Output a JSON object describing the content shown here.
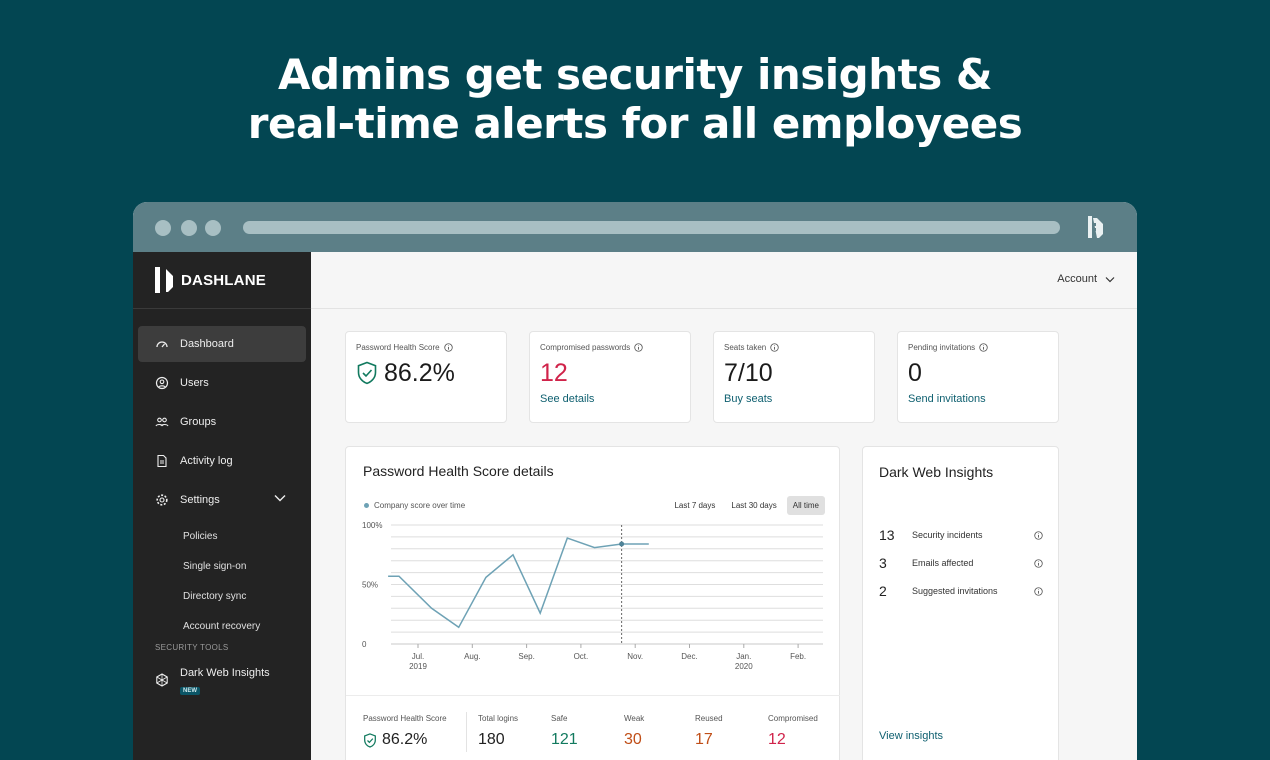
{
  "hero": {
    "line1": "Admins get security insights &",
    "line2": "real-time alerts for all employees"
  },
  "colors": {
    "background": "#034652",
    "sidebar": "#232323",
    "accent": "#0f6070",
    "red": "#d0234a",
    "green": "#127a5f",
    "orange": "#c04e17",
    "chart_line": "#6ea2b5"
  },
  "sidebar": {
    "brand": "DASHLANE",
    "items": [
      {
        "label": "Dashboard",
        "icon": "gauge-icon",
        "active": true
      },
      {
        "label": "Users",
        "icon": "user-circle-icon"
      },
      {
        "label": "Groups",
        "icon": "group-icon"
      },
      {
        "label": "Activity log",
        "icon": "document-icon"
      },
      {
        "label": "Settings",
        "icon": "gear-icon"
      }
    ],
    "settings_sub": [
      "Policies",
      "Single sign-on",
      "Directory sync",
      "Account recovery"
    ],
    "section_label": "SECURITY TOOLS",
    "dark_web": {
      "label": "Dark Web Insights",
      "badge": "NEW",
      "icon": "hexagon-icon"
    }
  },
  "topbar": {
    "account": "Account"
  },
  "stats": [
    {
      "title": "Password Health Score",
      "value": "86.2%",
      "link": ""
    },
    {
      "title": "Compromised passwords",
      "value": "12",
      "link": "See details"
    },
    {
      "title": "Seats taken",
      "value": "7/10",
      "link": "Buy seats"
    },
    {
      "title": "Pending invitations",
      "value": "0",
      "link": "Send invitations"
    }
  ],
  "details": {
    "title": "Password Health Score details",
    "legend": "Company score over time",
    "ranges": [
      "Last 7 days",
      "Last 30 days",
      "All time"
    ],
    "active_range": 2
  },
  "chart_data": {
    "type": "line",
    "x_ticks": [
      [
        "Jul.",
        "2019"
      ],
      [
        "Aug.",
        ""
      ],
      [
        "Sep.",
        ""
      ],
      [
        "Oct.",
        ""
      ],
      [
        "Nov.",
        ""
      ],
      [
        "Dec.",
        ""
      ],
      [
        "Jan.",
        "2020"
      ],
      [
        "Feb.",
        ""
      ]
    ],
    "y_ticks": [
      "100%",
      "50%",
      "0"
    ],
    "ylim": [
      0,
      100
    ],
    "series": [
      {
        "points": [
          [
            -0.55,
            57
          ],
          [
            -0.35,
            57
          ],
          [
            0.25,
            30
          ],
          [
            0.75,
            14
          ],
          [
            1.25,
            56
          ],
          [
            1.75,
            75
          ],
          [
            2.25,
            26
          ],
          [
            2.75,
            89
          ],
          [
            3.25,
            81
          ],
          [
            3.75,
            84
          ],
          [
            4.25,
            84
          ]
        ]
      }
    ],
    "marker_x": 3.75,
    "grid": true
  },
  "summary": [
    {
      "label": "Password Health Score",
      "value": "86.2%"
    },
    {
      "label": "Total logins",
      "value": "180"
    },
    {
      "label": "Safe",
      "value": "121"
    },
    {
      "label": "Weak",
      "value": "30"
    },
    {
      "label": "Reused",
      "value": "17"
    },
    {
      "label": "Compromised",
      "value": "12"
    }
  ],
  "dark_web_card": {
    "title": "Dark Web Insights",
    "rows": [
      {
        "num": "13",
        "label": "Security incidents"
      },
      {
        "num": "3",
        "label": "Emails affected"
      },
      {
        "num": "2",
        "label": "Suggested invitations"
      }
    ],
    "link": "View insights"
  }
}
